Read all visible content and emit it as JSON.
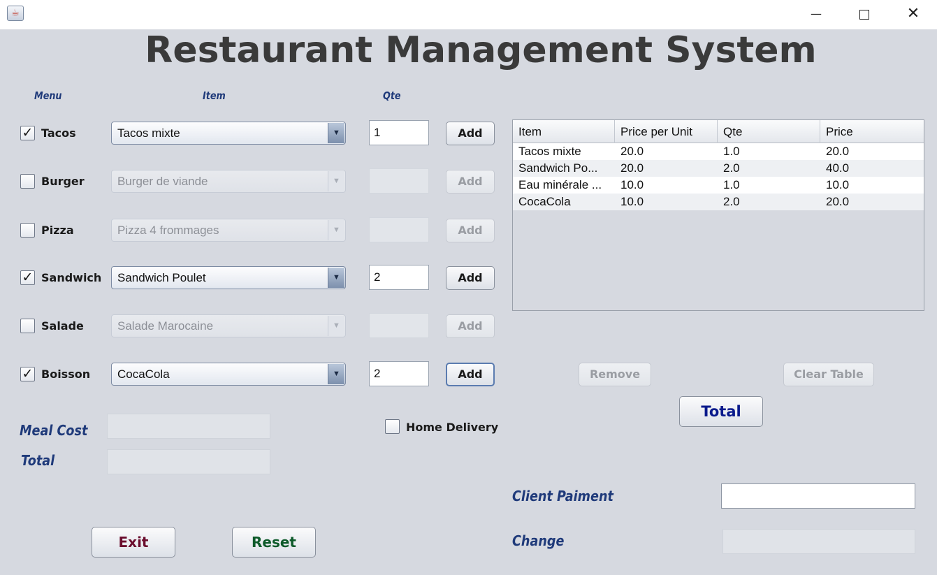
{
  "window": {
    "icon": "java-cup-icon",
    "minimize": "—",
    "close": "✕"
  },
  "title": "Restaurant Management System",
  "columns": {
    "menu": "Menu",
    "item": "Item",
    "qte": "Qte"
  },
  "rows": [
    {
      "label": "Tacos",
      "checked": true,
      "item": "Tacos mixte",
      "qty": "1",
      "add": "Add"
    },
    {
      "label": "Burger",
      "checked": false,
      "item": "Burger de viande",
      "qty": "",
      "add": "Add"
    },
    {
      "label": "Pizza",
      "checked": false,
      "item": "Pizza 4 frommages",
      "qty": "",
      "add": "Add"
    },
    {
      "label": "Sandwich",
      "checked": true,
      "item": "Sandwich Poulet",
      "qty": "2",
      "add": "Add"
    },
    {
      "label": "Salade",
      "checked": false,
      "item": "Salade Marocaine",
      "qty": "",
      "add": "Add"
    },
    {
      "label": "Boisson",
      "checked": true,
      "item": "CocaCola",
      "qty": "2",
      "add": "Add"
    }
  ],
  "check_mark": "✓",
  "dropdown_arrow": "▼",
  "order_table": {
    "headers": [
      "Item",
      "Price per Unit",
      "Qte",
      "Price"
    ],
    "rows": [
      [
        "Tacos mixte",
        "20.0",
        "1.0",
        "20.0"
      ],
      [
        "Sandwich Po...",
        "20.0",
        "2.0",
        "40.0"
      ],
      [
        "Eau minérale ...",
        "10.0",
        "1.0",
        "10.0"
      ],
      [
        "CocaCola",
        "10.0",
        "2.0",
        "20.0"
      ]
    ]
  },
  "buttons": {
    "remove": "Remove",
    "clear_table": "Clear Table",
    "total": "Total",
    "exit": "Exit",
    "reset": "Reset"
  },
  "home_delivery": {
    "label": "Home Delivery",
    "checked": false
  },
  "summary": {
    "meal_cost_label": "Meal Cost",
    "meal_cost": "",
    "total_label": "Total",
    "total": ""
  },
  "payment": {
    "client_label": "Client Paiment",
    "client_value": "",
    "change_label": "Change",
    "change_value": ""
  },
  "colors": {
    "background": "#d6d9e0",
    "label_blue": "#1f3a7a",
    "total_blue": "#0a1a8c",
    "exit_red": "#6b0e2e",
    "reset_green": "#0d5a2a"
  }
}
